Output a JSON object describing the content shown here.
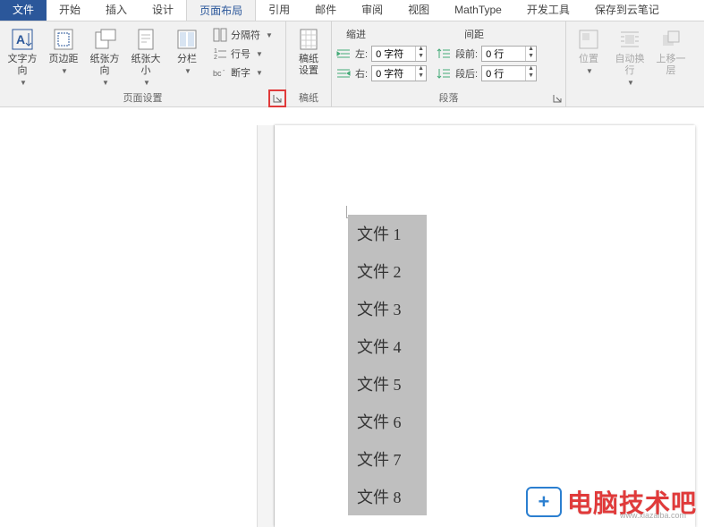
{
  "tabs": {
    "file": "文件",
    "items": [
      "开始",
      "插入",
      "设计",
      "页面布局",
      "引用",
      "邮件",
      "审阅",
      "视图",
      "MathType",
      "开发工具",
      "保存到云笔记"
    ],
    "active_index": 3
  },
  "ribbon": {
    "page_setup": {
      "label": "页面设置",
      "text_direction": "文字方向",
      "margins": "页边距",
      "orientation": "纸张方向",
      "size": "纸张大小",
      "columns": "分栏",
      "breaks": "分隔符",
      "line_numbers": "行号",
      "hyphenation": "断字"
    },
    "manuscript": {
      "label": "稿纸",
      "settings": "稿纸\n设置"
    },
    "paragraph": {
      "label": "段落",
      "indent_header": "缩进",
      "spacing_header": "间距",
      "left_label": "左:",
      "right_label": "右:",
      "before_label": "段前:",
      "after_label": "段后:",
      "left_value": "0 字符",
      "right_value": "0 字符",
      "before_value": "0 行",
      "after_value": "0 行"
    },
    "arrange": {
      "position": "位置",
      "wrap": "自动换行",
      "bring_forward": "上移一层"
    }
  },
  "document": {
    "items": [
      "文件 1",
      "文件 2",
      "文件 3",
      "文件 4",
      "文件 5",
      "文件 6",
      "文件 7",
      "文件 8"
    ]
  },
  "watermark": {
    "text": "电脑技术吧",
    "sub": "www.xiazaiba.com",
    "logo": "+"
  }
}
